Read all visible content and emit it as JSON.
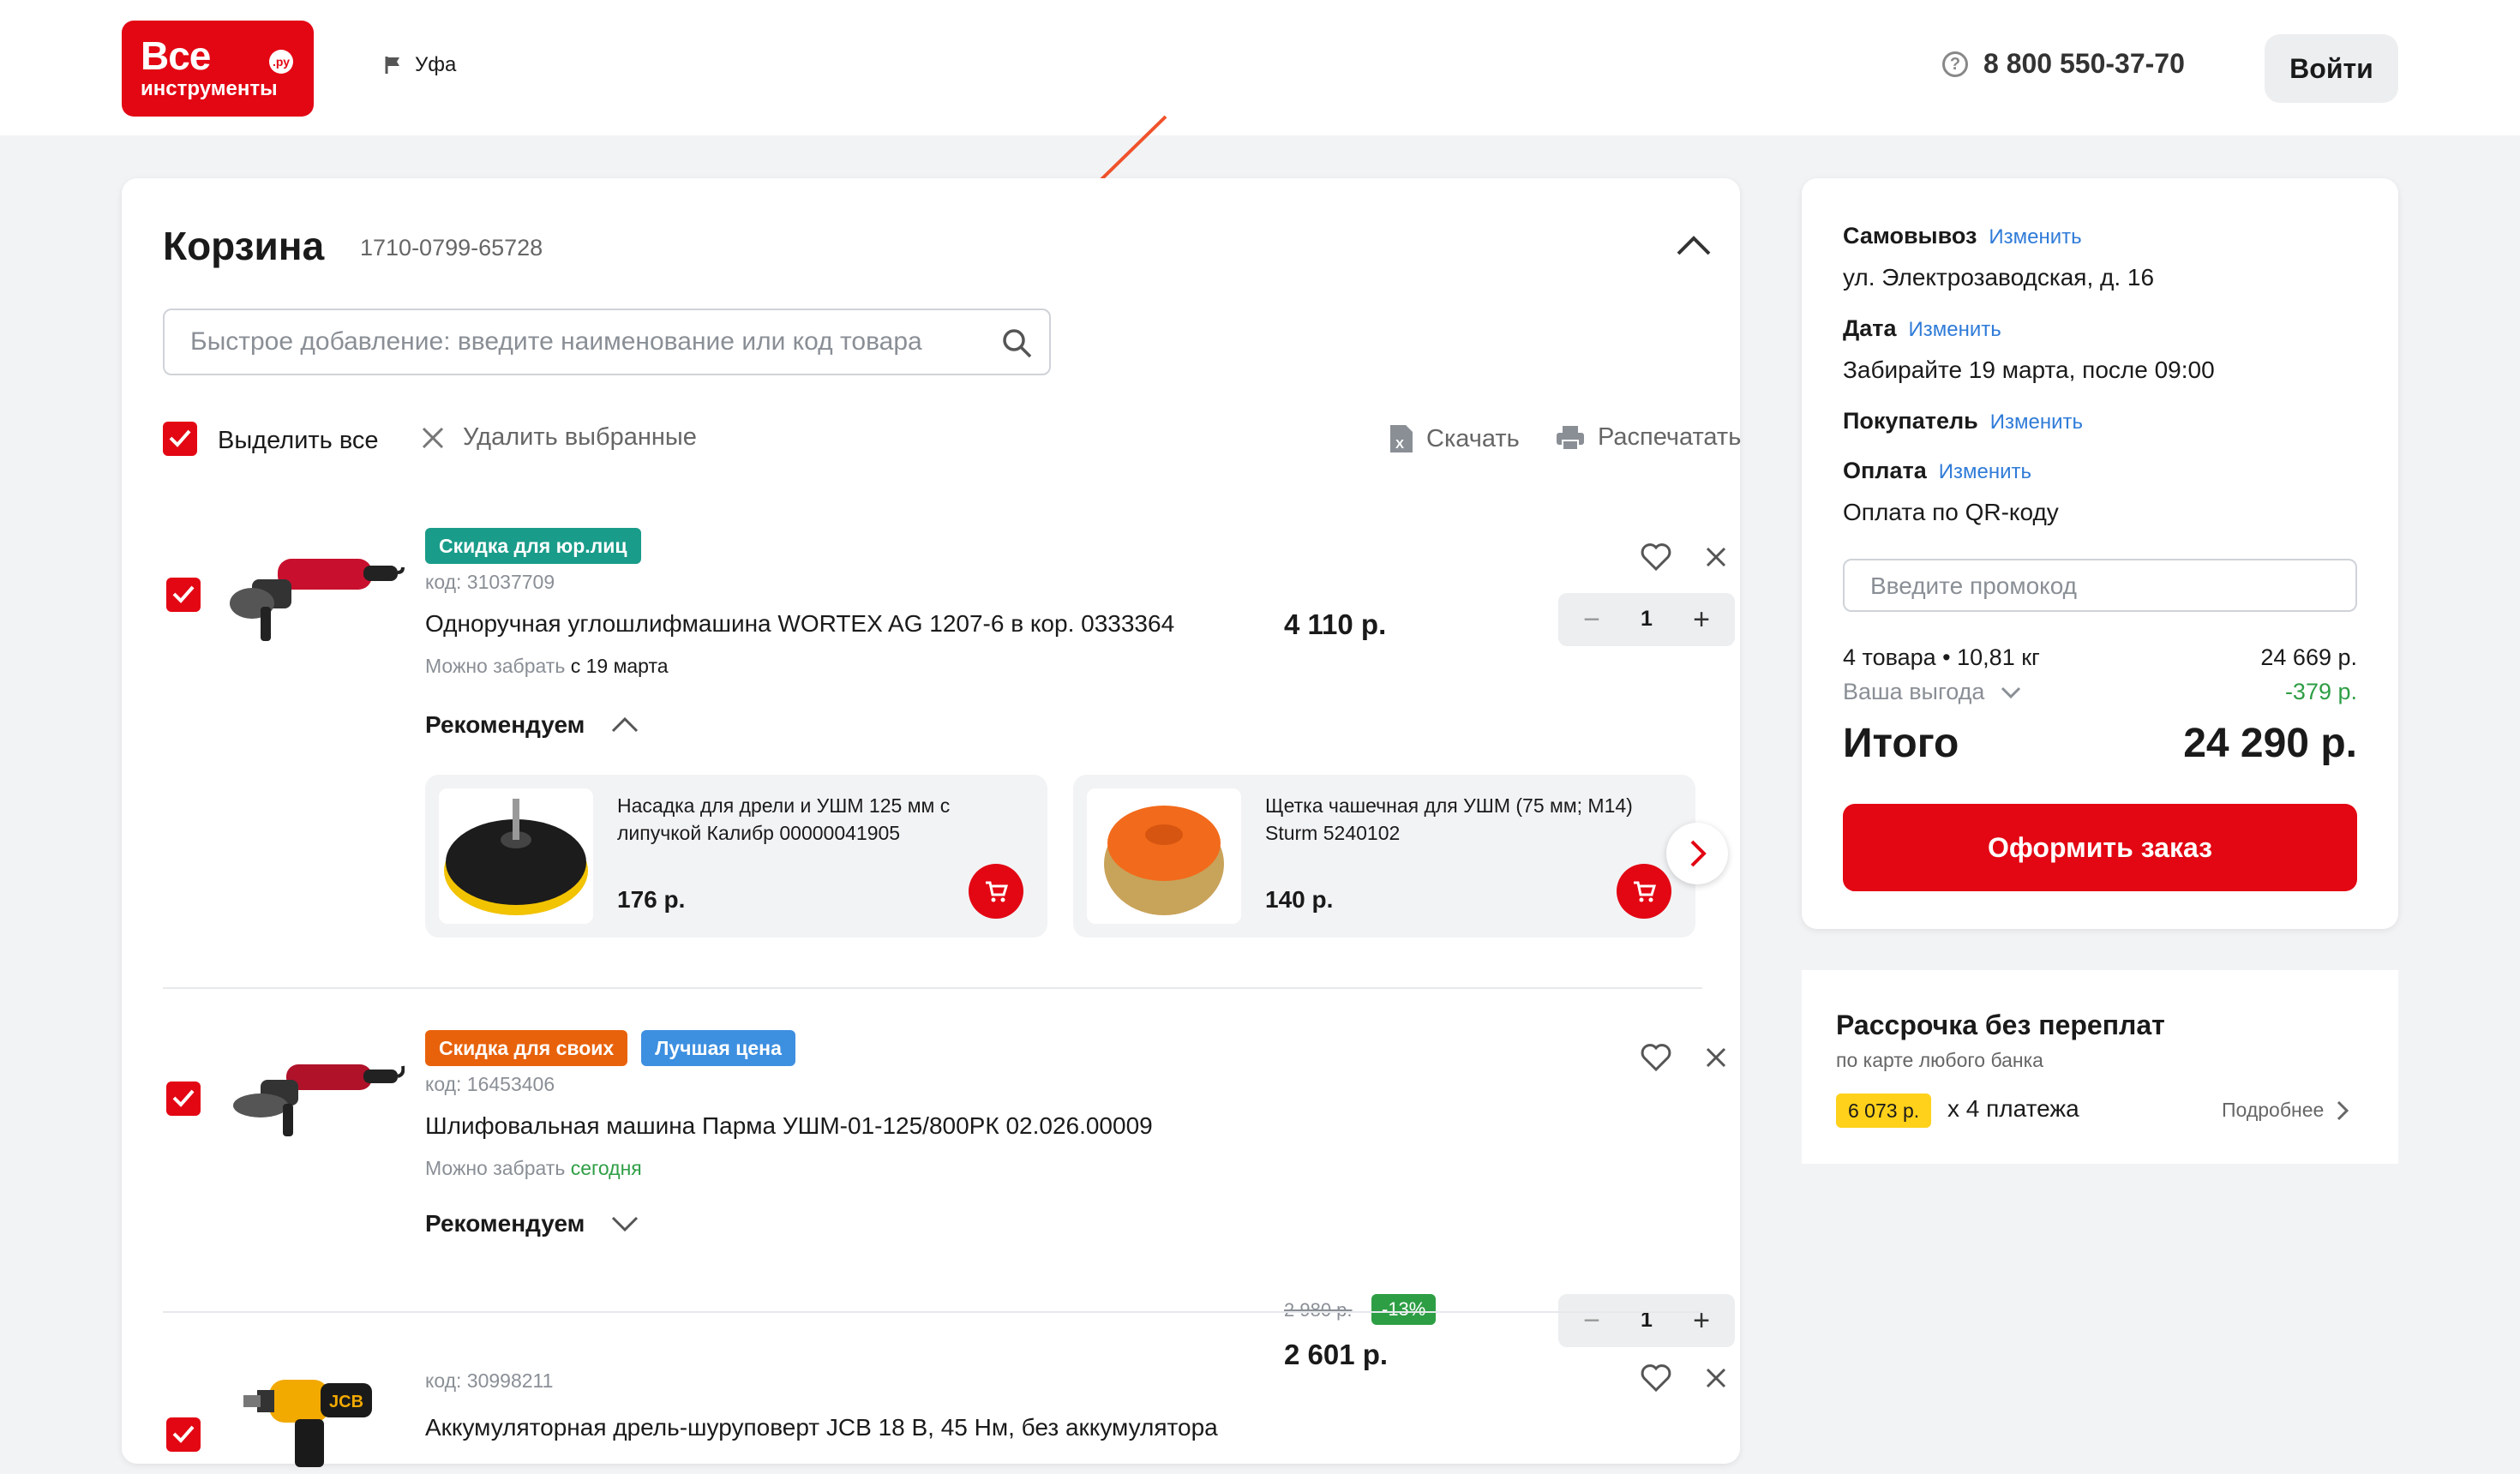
{
  "header": {
    "logo_line1": "Все",
    "logo_line2": "инструменты",
    "logo_ru": ".ру",
    "city": "Уфа",
    "phone": "8 800 550-37-70",
    "login_label": "Войти"
  },
  "cart": {
    "title": "Корзина",
    "cart_id": "1710-0799-65728",
    "search_placeholder": "Быстрое добавление: введите наименование или код товара",
    "select_all": "Выделить все",
    "delete_selected": "Удалить выбранные",
    "download": "Скачать",
    "print": "Распечатать",
    "items": [
      {
        "badges": [
          "Скидка для юр.лиц"
        ],
        "code": "код: 31037709",
        "name": "Одноручная углошлифмашина WORTEX AG 1207-6 в кор. 0333364",
        "avail_prefix": "Можно забрать",
        "avail_value": "с 19 марта",
        "price": "4 110 р.",
        "qty": "1",
        "rec_title": "Рекомендуем",
        "recs": [
          {
            "name": "Насадка для дрели и УШМ 125 мм с липучкой Калибр 00000041905",
            "price": "176 р."
          },
          {
            "name": "Щетка чашечная для УШМ (75 мм; М14) Sturm 5240102",
            "price": "140 р."
          }
        ]
      },
      {
        "badges": [
          "Скидка для своих",
          "Лучшая цена"
        ],
        "code": "код: 16453406",
        "name": "Шлифовальная машина Парма УШМ-01-125/800РК 02.026.00009",
        "avail_prefix": "Можно забрать",
        "avail_value": "сегодня",
        "old_price": "2 980 р.",
        "discount": "-13%",
        "price": "2 601 р.",
        "qty": "1",
        "rec_title": "Рекомендуем"
      },
      {
        "code": "код: 30998211",
        "name": "Аккумуляторная дрель-шуруповерт JCB 18 В, 45 Нм, без аккумулятора"
      }
    ]
  },
  "summary": {
    "pickup_label": "Самовывоз",
    "pickup_value": "ул. Электрозаводская, д. 16",
    "date_label": "Дата",
    "date_value": "Забирайте 19 марта, после 09:00",
    "buyer_label": "Покупатель",
    "payment_label": "Оплата",
    "payment_value": "Оплата по QR-коду",
    "change_link": "Изменить",
    "promo_placeholder": "Введите промокод",
    "items_count": "4 товара • 10,81 кг",
    "items_sum": "24 669 р.",
    "benefit_label": "Ваша выгода",
    "benefit_value": "-379 р.",
    "total_label": "Итого",
    "total_value": "24 290 р.",
    "order_button": "Оформить заказ"
  },
  "installment": {
    "title": "Рассрочка без переплат",
    "subtitle": "по карте любого банка",
    "amount": "6 073 р.",
    "payments": "х 4 платежа",
    "more": "Подробнее"
  },
  "colors": {
    "brand_red": "#e30613",
    "badge_teal": "#1a9c8a",
    "badge_orange": "#e8620c",
    "badge_blue": "#3d8fe0",
    "discount_green": "#2e9e45",
    "link_blue": "#2f7bd8",
    "annotation_arrow": "#f0522b"
  }
}
